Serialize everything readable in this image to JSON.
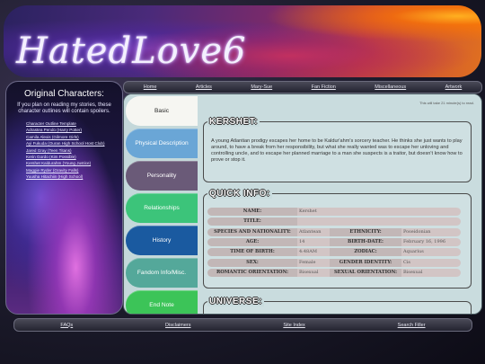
{
  "banner": {
    "title": "HatedLove6"
  },
  "sidebar": {
    "heading": "Original Characters:",
    "note": "If you plan on reading my stories, these character outlines will contain spoilers.",
    "links": [
      "Character Outline Template",
      "Adrastea Pendo (Harry Potter)",
      "Camila Alexis (Gilmore Girls)",
      "Ayi Fukuda (Ouran High School Host Club)",
      "Jared Gray (Teen Titans)",
      "Kerin Gordo (Kim Possible)",
      "Kershet Kaldurahm (Young Justice)",
      "Maggie Ryder (Gravity Falls)",
      "Yuusha Hitachiin (High School)"
    ]
  },
  "topnav": [
    "Home",
    "Articles",
    "Mary-Sue",
    "Fan Fiction",
    "Miscellaneous",
    "Artwork"
  ],
  "tabs": [
    {
      "label": "Basic",
      "color": "#f6f6f2",
      "active": true
    },
    {
      "label": "Physical Description",
      "color": "#6aa6d6"
    },
    {
      "label": "Personality",
      "color": "#6a5a78"
    },
    {
      "label": "Relationships",
      "color": "#3cc47a"
    },
    {
      "label": "History",
      "color": "#1a5aa0"
    },
    {
      "label": "Fandom Info/Misc.",
      "color": "#54a89a"
    },
    {
      "label": "End Note",
      "color": "#3cc458"
    }
  ],
  "content": {
    "read_time": "This will take 21 minute(s) to read.",
    "kershet": {
      "heading": "KERSHET:",
      "text": "A young Atlantian prodigy escapes her home to be Kaldur'ahm's sorcery teacher. He thinks she just wants to play around, to have a break from her responsibility, but what she really wanted was to escape her unloving and controlling uncle, and to escape her planned marriage to a man she suspects is a traitor, but doesn't know how to prove or stop it."
    },
    "quick_info": {
      "heading": "QUICK INFO:",
      "rows": [
        {
          "l1": "NAME:",
          "v1": "Kershet"
        },
        {
          "l1": "TITLE:",
          "v1": ""
        },
        {
          "l1": "SPECIES AND NATIONALITY:",
          "v1": "Atlantean",
          "l2": "ETHNICITY:",
          "v2": "Poseidonian"
        },
        {
          "l1": "AGE:",
          "v1": "14",
          "l2": "BIRTH-DATE:",
          "v2": "February 16, 1996"
        },
        {
          "l1": "TIME OF BIRTH:",
          "v1": "4:48AM",
          "l2": "ZODIAC:",
          "v2": "Aquarius"
        },
        {
          "l1": "SEX:",
          "v1": "Female",
          "l2": "GENDER IDENTITY:",
          "v2": "Cis"
        },
        {
          "l1": "ROMANTIC ORIENTATION:",
          "v1": "Bisexual",
          "l2": "SEXUAL ORIENTATION:",
          "v2": "Bisexual"
        }
      ]
    },
    "universe": {
      "heading": "UNIVERSE:"
    }
  },
  "bottomnav": [
    "FAQs",
    "Disclaimers",
    "Site Index",
    "Search Filler"
  ]
}
